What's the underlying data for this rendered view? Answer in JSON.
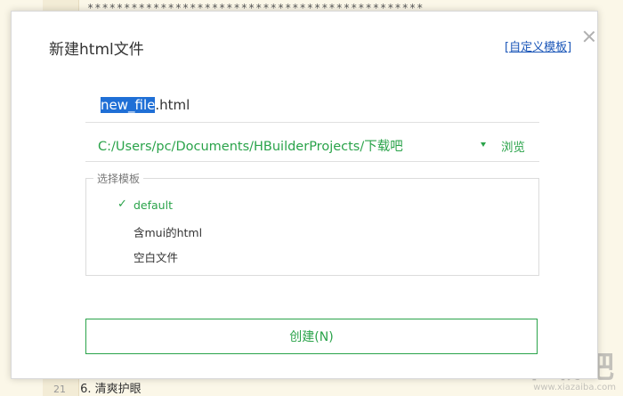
{
  "background": {
    "stars": "**********************************************",
    "line_number": "21",
    "line_text": "6. 清爽护眼"
  },
  "watermark": {
    "big": "下载吧",
    "small": "www.xiazaiba.com"
  },
  "dialog": {
    "title": "新建html文件",
    "custom_template_bracket_open": "[",
    "custom_template_label": "自定义模板",
    "custom_template_bracket_close": "]",
    "filename_selected": "new_file",
    "filename_ext": ".html",
    "path": "C:/Users/pc/Documents/HBuilderProjects/下载吧",
    "browse_label": "浏览",
    "template_legend": "选择模板",
    "templates": [
      {
        "label": "default",
        "selected": true
      },
      {
        "label": "含mui的html",
        "selected": false
      },
      {
        "label": "空白文件",
        "selected": false
      }
    ],
    "create_label": "创建(N)"
  },
  "colors": {
    "accent": "#2aa34a",
    "link": "#1a56b8",
    "selection": "#1f6fd6"
  }
}
